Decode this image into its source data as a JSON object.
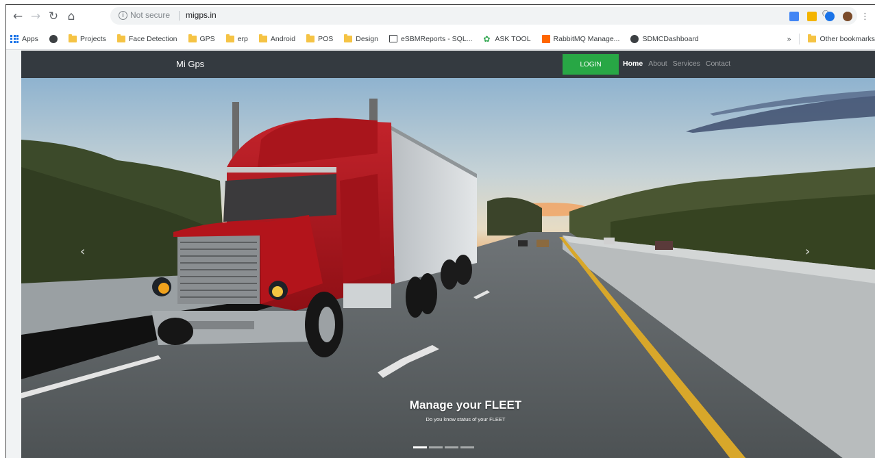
{
  "browser": {
    "security_label": "Not secure",
    "url": "migps.in",
    "bookmarks": [
      {
        "label": "Apps",
        "icon": "apps-grid-icon"
      },
      {
        "label": "",
        "icon": "globe-icon"
      },
      {
        "label": "Projects",
        "icon": "folder-icon"
      },
      {
        "label": "Face Detection",
        "icon": "folder-icon"
      },
      {
        "label": "GPS",
        "icon": "folder-icon"
      },
      {
        "label": "erp",
        "icon": "folder-icon"
      },
      {
        "label": "Android",
        "icon": "folder-icon"
      },
      {
        "label": "POS",
        "icon": "folder-icon"
      },
      {
        "label": "Design",
        "icon": "folder-icon"
      },
      {
        "label": "eSBMReports - SQL...",
        "icon": "image-icon"
      },
      {
        "label": "ASK TOOL",
        "icon": "leaf-icon"
      },
      {
        "label": "RabbitMQ Manage...",
        "icon": "rabbitmq-icon"
      },
      {
        "label": "SDMCDashboard",
        "icon": "globe-icon"
      }
    ],
    "overflow_label": "»",
    "other_bookmarks": "Other bookmarks"
  },
  "site": {
    "brand": "Mi Gps",
    "login_label": "LOGIN",
    "nav": [
      {
        "label": "Home",
        "active": true
      },
      {
        "label": "About",
        "active": false
      },
      {
        "label": "Services",
        "active": false
      },
      {
        "label": "Contact",
        "active": false
      }
    ]
  },
  "carousel": {
    "title": "Manage your FLEET",
    "subtitle": "Do you know status of your FLEET",
    "prev_icon": "chevron-left-icon",
    "next_icon": "chevron-right-icon",
    "indicators": [
      true,
      false,
      false,
      false
    ]
  },
  "colors": {
    "navbar": "#343a40",
    "login": "#28a745",
    "truck": "#b3141b"
  }
}
